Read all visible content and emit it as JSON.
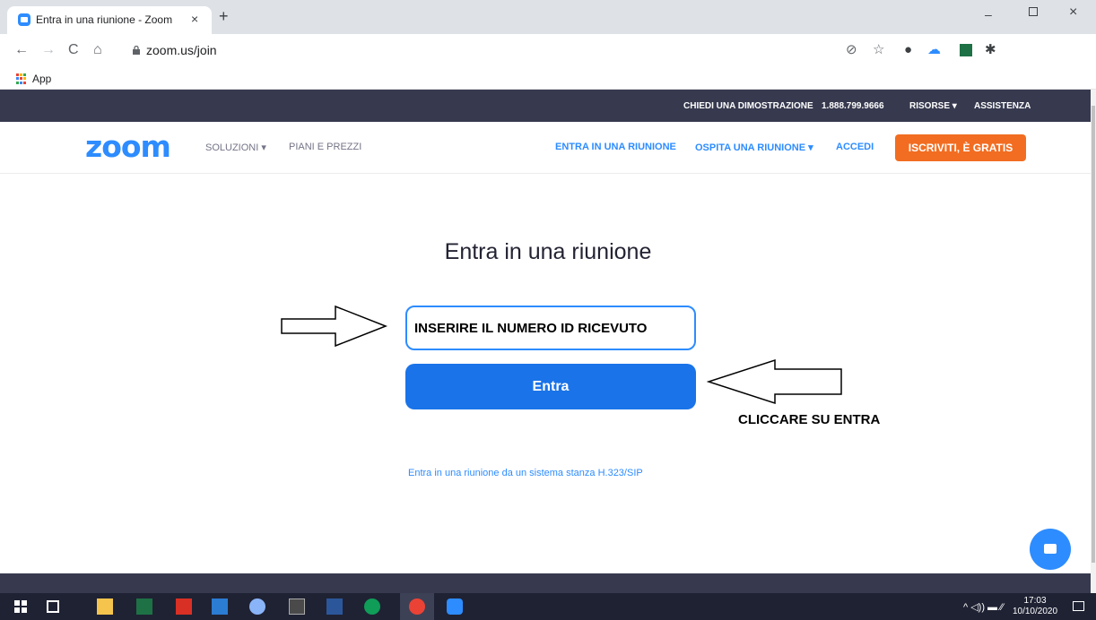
{
  "browser": {
    "tab_title": "Entra in una riunione - Zoom",
    "tab_close": "×",
    "new_tab": "+",
    "url": "zoom.us/join",
    "bookmarks_apps_label": "App",
    "window_controls": {
      "minimize": "–",
      "close": "×"
    }
  },
  "topbar": {
    "demo": "CHIEDI UNA DIMOSTRAZIONE",
    "phone": "1.888.799.9666",
    "resources": "RISORSE ▾",
    "support": "ASSISTENZA"
  },
  "nav": {
    "logo": "zoom",
    "solutions": "SOLUZIONI ▾",
    "plans": "PIANI E PREZZI",
    "join": "ENTRA IN UNA RIUNIONE",
    "host": "OSPITA UNA RIUNIONE ▾",
    "signin": "ACCEDI",
    "signup": "ISCRIVITI, È GRATIS"
  },
  "main": {
    "heading": "Entra in una riunione",
    "meeting_id_value": "INSERIRE IL NUMERO ID RICEVUTO",
    "join_button": "Entra",
    "h323_link": "Entra in una riunione da un sistema stanza H.323/SIP"
  },
  "annotations": {
    "click_join": "CLICCARE SU ENTRA"
  },
  "taskbar": {
    "tray": "^ ◁)) ▬ ⁄⁄",
    "time": "17:03",
    "date": "10/10/2020"
  },
  "colors": {
    "zoom_blue": "#2d8cff",
    "join_blue": "#1a73e8",
    "signup_orange": "#f26d21",
    "dark_bar": "#373a4f"
  }
}
